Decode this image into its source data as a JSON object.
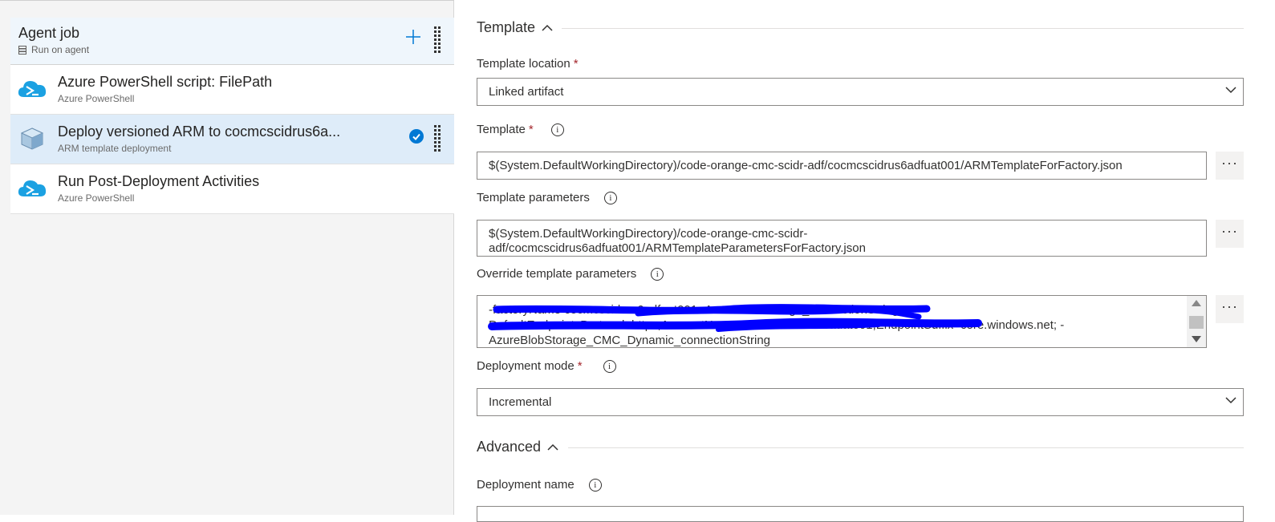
{
  "agent_job": {
    "title": "Agent job",
    "subtitle": "Run on agent"
  },
  "tasks": [
    {
      "title": "Azure PowerShell script: FilePath",
      "subtitle": "Azure PowerShell",
      "icon": "azure-powershell-icon",
      "selected": false
    },
    {
      "title": "Deploy versioned ARM to cocmcscidrus6a...",
      "subtitle": "ARM template deployment",
      "icon": "arm-deployment-icon",
      "selected": true
    },
    {
      "title": "Run Post-Deployment Activities",
      "subtitle": "Azure PowerShell",
      "icon": "azure-powershell-icon",
      "selected": false
    }
  ],
  "template_section": {
    "heading": "Template",
    "template_location": {
      "label": "Template location",
      "value": "Linked artifact"
    },
    "template": {
      "label": "Template",
      "value": "$(System.DefaultWorkingDirectory)/code-orange-cmc-scidr-adf/cocmcscidrus6adfuat001/ARMTemplateForFactory.json"
    },
    "template_parameters": {
      "label": "Template parameters",
      "line1": "$(System.DefaultWorkingDirectory)/code-orange-cmc-scidr-",
      "line2": "adf/cocmcscidrus6adfuat001/ARMTemplateParametersForFactory.json"
    },
    "override_parameters": {
      "label": "Override template parameters",
      "line1": "-factoryName cocmcscidrus6adfuat001 -AzureBlobStorage_connectionString",
      "line2": "DefaultEndpointsProtocol=https;AccountName=cocmcscidrus6sauat001;EndpointSuffix=core.windows.net; -",
      "line3": "AzureBlobStorage_CMC_Dynamic_connectionString"
    },
    "deployment_mode": {
      "label": "Deployment mode",
      "value": "Incremental"
    }
  },
  "advanced_section": {
    "heading": "Advanced",
    "deployment_name": {
      "label": "Deployment name"
    }
  },
  "required_marker": "*",
  "info_glyph": "i",
  "ellipsis": "···",
  "colors": {
    "accent": "#0078d4",
    "selected_row": "#deecf9",
    "agent_row": "#eff6fc",
    "redaction": "#0000ff",
    "azure_icon": "#1ba1e2"
  }
}
